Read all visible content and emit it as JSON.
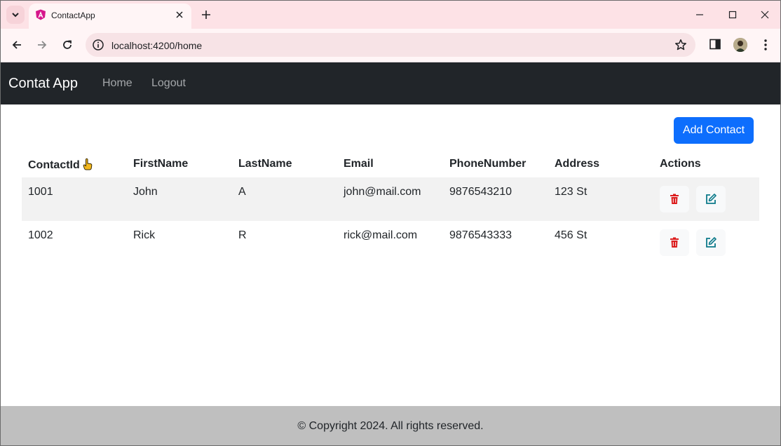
{
  "browser": {
    "tab_title": "ContactApp",
    "url": "localhost:4200/home"
  },
  "navbar": {
    "brand": "Contat App",
    "links": [
      "Home",
      "Logout"
    ]
  },
  "toolbar": {
    "add_label": "Add Contact"
  },
  "table": {
    "columns": [
      "ContactId",
      "FirstName",
      "LastName",
      "Email",
      "PhoneNumber",
      "Address",
      "Actions"
    ],
    "rows": [
      [
        "1001",
        "John",
        "A",
        "john@mail.com",
        "9876543210",
        "123 St"
      ],
      [
        "1002",
        "Rick",
        "R",
        "rick@mail.com",
        "9876543333",
        "456 St"
      ]
    ],
    "row_actions": [
      "trash-icon",
      "edit-icon"
    ]
  },
  "footer": {
    "text": "© Copyright 2024. All rights reserved."
  },
  "colors": {
    "navbar": "#212529",
    "primary": "#0d6efd",
    "danger": "#dc3545",
    "edit": "#0d7a8a",
    "footer": "#bfbfbf",
    "tabstrip": "#fde2e6"
  }
}
